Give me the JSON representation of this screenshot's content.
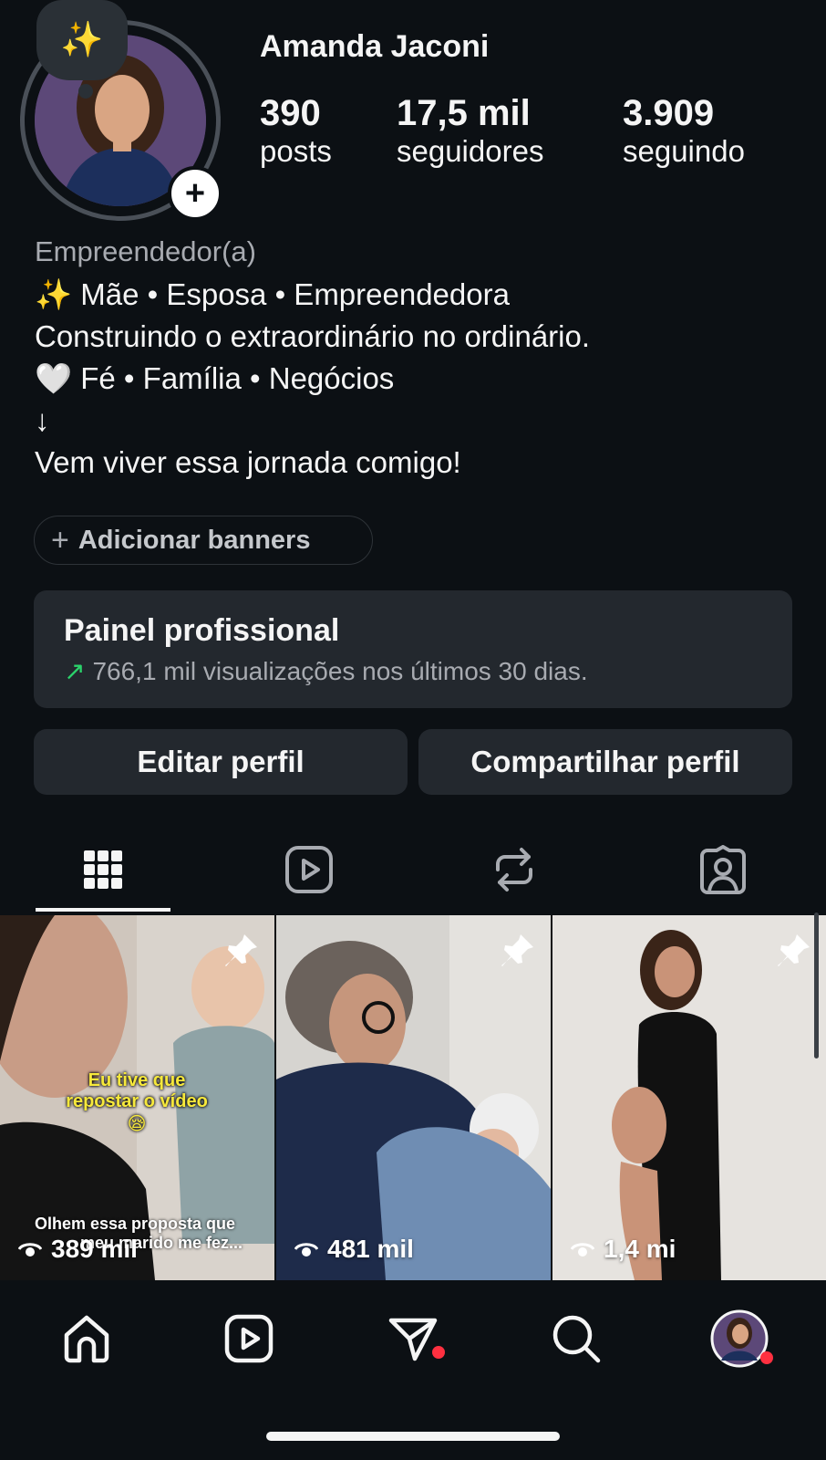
{
  "profile": {
    "note_emoji": "✨",
    "add_story_symbol": "+",
    "username": "Amanda Jaconi",
    "stats": {
      "posts": {
        "value": "390",
        "label": "posts"
      },
      "followers": {
        "value": "17,5 mil",
        "label": "seguidores"
      },
      "following": {
        "value": "3.909",
        "label": "seguindo"
      }
    }
  },
  "bio": {
    "category": "Empreendedor(a)",
    "line1": "✨ Mãe • Esposa • Empreendedora",
    "line2": "Construindo o extraordinário no ordinário.",
    "line3": "🤍 Fé • Família • Negócios",
    "line4": "↓",
    "line5": "Vem viver essa jornada comigo!"
  },
  "banner_button": {
    "plus": "+",
    "label": "Adicionar banners"
  },
  "dashboard": {
    "title": "Painel profissional",
    "arrow": "↗",
    "subtitle": "766,1 mil visualizações nos últimos 30 dias."
  },
  "actions": {
    "edit": "Editar perfil",
    "share": "Compartilhar perfil"
  },
  "tabs": [
    {
      "icon": "grid-icon",
      "active": true
    },
    {
      "icon": "reels-icon",
      "active": false
    },
    {
      "icon": "reposts-icon",
      "active": false
    },
    {
      "icon": "tagged-icon",
      "active": false
    }
  ],
  "posts": [
    {
      "views": "389 mil",
      "pinned": true,
      "overlay_top_1": "Eu tive que",
      "overlay_top_2": "repostar o vídeo 😪",
      "overlay_bottom_1": "Olhem essa proposta que",
      "overlay_bottom_2": "meu marido me fez..."
    },
    {
      "views": "481 mil",
      "pinned": true
    },
    {
      "views": "1,4 mi",
      "pinned": true
    }
  ],
  "nav": {
    "items": [
      "home-icon",
      "reels-icon",
      "direct-icon",
      "search-icon",
      "profile-avatar"
    ],
    "notification_color": "#ff3040"
  },
  "colors": {
    "background": "#0c1014",
    "card": "#23282e",
    "muted": "#a8abb1",
    "accent_green": "#2bd36b"
  }
}
